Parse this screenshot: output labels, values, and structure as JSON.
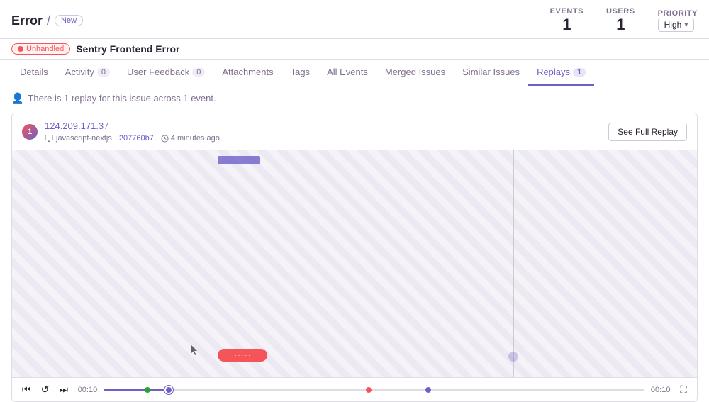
{
  "header": {
    "breadcrumb_error": "Error",
    "breadcrumb_sep": "/",
    "new_badge": "New",
    "stats": {
      "events_label": "EVENTS",
      "events_value": "1",
      "users_label": "USERS",
      "users_value": "1",
      "priority_label": "PRIORITY",
      "priority_value": "High"
    }
  },
  "error_title": {
    "unhandled": "Unhandled",
    "name": "Sentry Frontend Error"
  },
  "tabs": [
    {
      "id": "details",
      "label": "Details",
      "count": null
    },
    {
      "id": "activity",
      "label": "Activity",
      "count": "0"
    },
    {
      "id": "user-feedback",
      "label": "User Feedback",
      "count": "0"
    },
    {
      "id": "attachments",
      "label": "Attachments",
      "count": null
    },
    {
      "id": "tags",
      "label": "Tags",
      "count": null
    },
    {
      "id": "all-events",
      "label": "All Events",
      "count": null
    },
    {
      "id": "merged-issues",
      "label": "Merged Issues",
      "count": null
    },
    {
      "id": "similar-issues",
      "label": "Similar Issues",
      "count": null
    },
    {
      "id": "replays",
      "label": "Replays",
      "count": "1"
    }
  ],
  "info_bar": {
    "message": "There is 1 replay for this issue across 1 event."
  },
  "replay": {
    "user_ip": "124.209.171.37",
    "platform": "javascript-nextjs",
    "commit": "207760b7",
    "time_ago": "4 minutes ago",
    "see_full_replay": "See Full Replay",
    "mock_button_label": "· · · · ·",
    "timeline": {
      "start_time": "00:10",
      "end_time": "00:10",
      "progress_pct": 12,
      "dots": [
        {
          "color": "green",
          "pct": 8
        },
        {
          "color": "red",
          "pct": 49
        },
        {
          "color": "blue",
          "pct": 60
        }
      ]
    }
  }
}
